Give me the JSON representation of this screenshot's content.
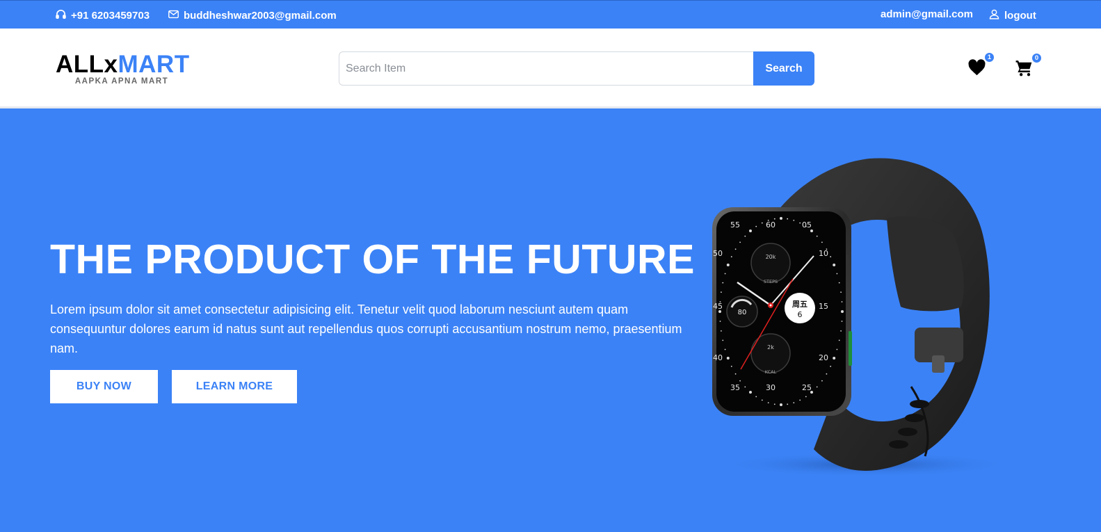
{
  "topbar": {
    "phone": "+91 6203459703",
    "email": "buddheshwar2003@gmail.com",
    "user_email": "admin@gmail.com",
    "logout_label": "logout"
  },
  "header": {
    "logo_part1": "ALLx",
    "logo_part2": "MART",
    "tagline": "AAPKA APNA MART",
    "search_placeholder": "Search Item",
    "search_value": "",
    "search_button": "Search",
    "wishlist_count": "1",
    "cart_count": "0"
  },
  "hero": {
    "title": "THE PRODUCT OF THE FUTURE",
    "description": "Lorem ipsum dolor sit amet consectetur adipisicing elit. Tenetur velit quod laborum nesciunt autem quam consequuntur dolores earum id natus sunt aut repellendus quos corrupti accusantium nostrum nemo, praesentium nam.",
    "buy_button": "BUY NOW",
    "learn_button": "LEARN MORE"
  },
  "watch": {
    "face_numbers": [
      "55",
      "60",
      "05",
      "10",
      "15",
      "20",
      "25",
      "30",
      "35",
      "40",
      "45",
      "50"
    ],
    "sub_top": "20k",
    "sub_top_label": "STEPS",
    "sub_bottom": "2k",
    "sub_bottom_label": "KCAL",
    "sub_left": "80",
    "date_line1": "周五",
    "date_line2": "6"
  },
  "colors": {
    "primary": "#3b82f6",
    "white": "#ffffff",
    "dark": "#000000"
  }
}
